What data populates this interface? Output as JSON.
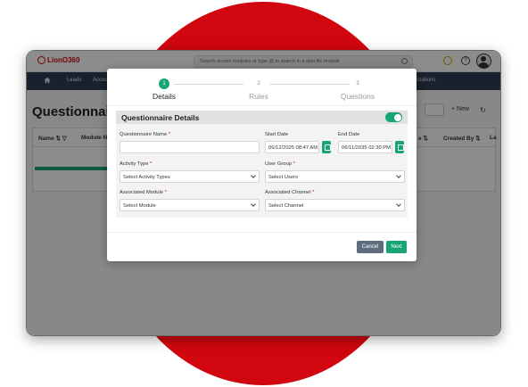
{
  "colors": {
    "brand_red": "#d1060e",
    "accent_green": "#17a673",
    "navbar": "#2d3c52"
  },
  "app": {
    "logo_text": "LionO360",
    "search_placeholder": "Search across modules or type @ to search in a specific module",
    "nav": {
      "leads": "Leads",
      "accounts": "Accou",
      "organizations": "izations"
    },
    "page_title": "Questionnaire",
    "new_label": "+ New",
    "columns": [
      "Name",
      "Module Nam",
      "e",
      "Created By",
      "La"
    ]
  },
  "modal": {
    "steps": [
      {
        "num": "1",
        "label": "Details"
      },
      {
        "num": "2",
        "label": "Rules"
      },
      {
        "num": "3",
        "label": "Questions"
      }
    ],
    "section_title": "Questionnaire Details",
    "fields": {
      "name_label": "Questionnaire Name",
      "start_label": "Start Date",
      "start_value": "06/12/2025 08:47 AM",
      "end_label": "End Date",
      "end_value": "06/11/2035 02:30 PM",
      "activity_label": "Activity Type",
      "activity_value": "Select Activity Types",
      "group_label": "User Group",
      "group_value": "Select Users",
      "module_label": "Associated Module",
      "module_value": "Select Module",
      "channel_label": "Associated Channel",
      "channel_value": "Select Channel"
    },
    "required_mark": "*",
    "cancel_label": "Cancel",
    "next_label": "Next"
  }
}
